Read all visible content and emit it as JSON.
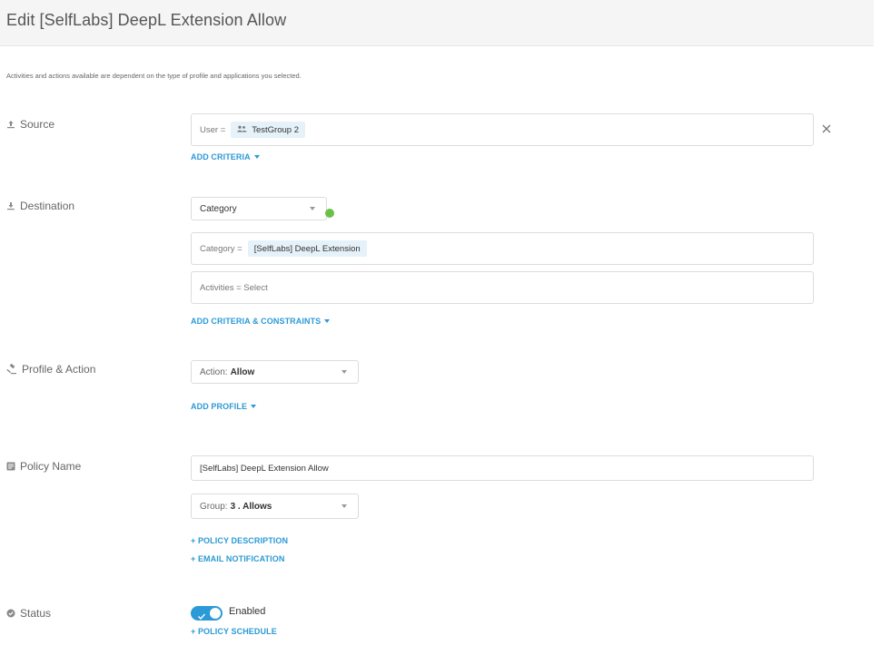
{
  "header": {
    "title": "Edit [SelfLabs] DeepL Extension Allow"
  },
  "intro": "Activities and actions available are dependent on the type of profile and applications you selected.",
  "source": {
    "label": "Source",
    "criteria_prefix": "User =",
    "criteria_value": "TestGroup 2",
    "add_link": "ADD CRITERIA"
  },
  "destination": {
    "label": "Destination",
    "type_select": "Category",
    "category_prefix": "Category =",
    "category_value": "[SelfLabs] DeepL Extension",
    "activities_text": "Activities = Select",
    "add_link": "ADD CRITERIA & CONSTRAINTS"
  },
  "profile_action": {
    "label": "Profile & Action",
    "action_prefix": "Action:",
    "action_value": "Allow",
    "add_link": "ADD PROFILE"
  },
  "policy_name": {
    "label": "Policy Name",
    "value": "[SelfLabs] DeepL Extension Allow",
    "group_prefix": "Group:",
    "group_value": "3 . Allows",
    "description_link": "+ POLICY DESCRIPTION",
    "email_link": "+ EMAIL NOTIFICATION"
  },
  "status": {
    "label": "Status",
    "toggle_label": "Enabled",
    "enabled": true,
    "schedule_link": "+ POLICY SCHEDULE"
  },
  "colors": {
    "accent": "#2b9ad6",
    "chip_bg": "#e6f2f9",
    "status_dot": "#6cc04a"
  }
}
